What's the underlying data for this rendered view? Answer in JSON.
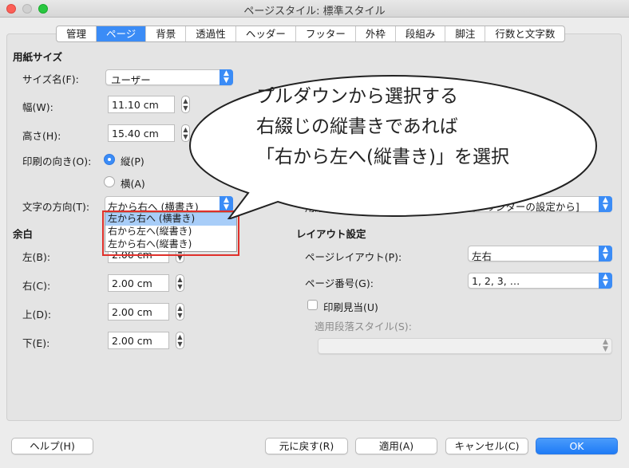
{
  "window": {
    "title": "ページスタイル: 標準スタイル"
  },
  "tabs": [
    {
      "label": "管理",
      "active": false
    },
    {
      "label": "ページ",
      "active": true
    },
    {
      "label": "背景",
      "active": false
    },
    {
      "label": "透過性",
      "active": false
    },
    {
      "label": "ヘッダー",
      "active": false
    },
    {
      "label": "フッター",
      "active": false
    },
    {
      "label": "外枠",
      "active": false
    },
    {
      "label": "段組み",
      "active": false
    },
    {
      "label": "脚注",
      "active": false
    },
    {
      "label": "行数と文字数",
      "active": false
    }
  ],
  "paper": {
    "heading": "用紙サイズ",
    "size_name_label": "サイズ名(F):",
    "size_name_value": "ユーザー",
    "width_label": "幅(W):",
    "width_value": "11.10 cm",
    "height_label": "高さ(H):",
    "height_value": "15.40 cm",
    "orientation_label": "印刷の向き(O):",
    "portrait_label": "縦(P)",
    "landscape_label": "横(A)",
    "text_direction_label": "文字の方向(T):",
    "text_direction_value": "左から右へ (横書き)",
    "text_direction_options": [
      "左から右へ (横書き)",
      "右から左へ(縦書き)",
      "左から右へ(縦書き)"
    ],
    "paper_tray_label": "用紙トレイ(T):",
    "paper_tray_value": "[プリンターの設定から]"
  },
  "margins": {
    "heading": "余白",
    "left_label": "左(B):",
    "left_value": "2.00 cm",
    "right_label": "右(C):",
    "right_value": "2.00 cm",
    "top_label": "上(D):",
    "top_value": "2.00 cm",
    "bottom_label": "下(E):",
    "bottom_value": "2.00 cm"
  },
  "layout": {
    "heading": "レイアウト設定",
    "page_layout_label": "ページレイアウト(P):",
    "page_layout_value": "左右",
    "page_number_label": "ページ番号(G):",
    "page_number_value": "1, 2, 3, …",
    "register_true_label": "印刷見当(U)",
    "reference_style_label": "適用段落スタイル(S):",
    "reference_style_value": ""
  },
  "callout": {
    "lines": [
      "プルダウンから選択する",
      "右綴じの縦書きであれば",
      "「右から左へ(縦書き)」を選択"
    ]
  },
  "buttons": {
    "help": "ヘルプ(H)",
    "reset": "元に戻す(R)",
    "apply": "適用(A)",
    "cancel": "キャンセル(C)",
    "ok": "OK"
  },
  "colors": {
    "accent": "#3b8cf6",
    "highlight_box": "#e0302a",
    "selected_option": "#a8cdf8"
  }
}
